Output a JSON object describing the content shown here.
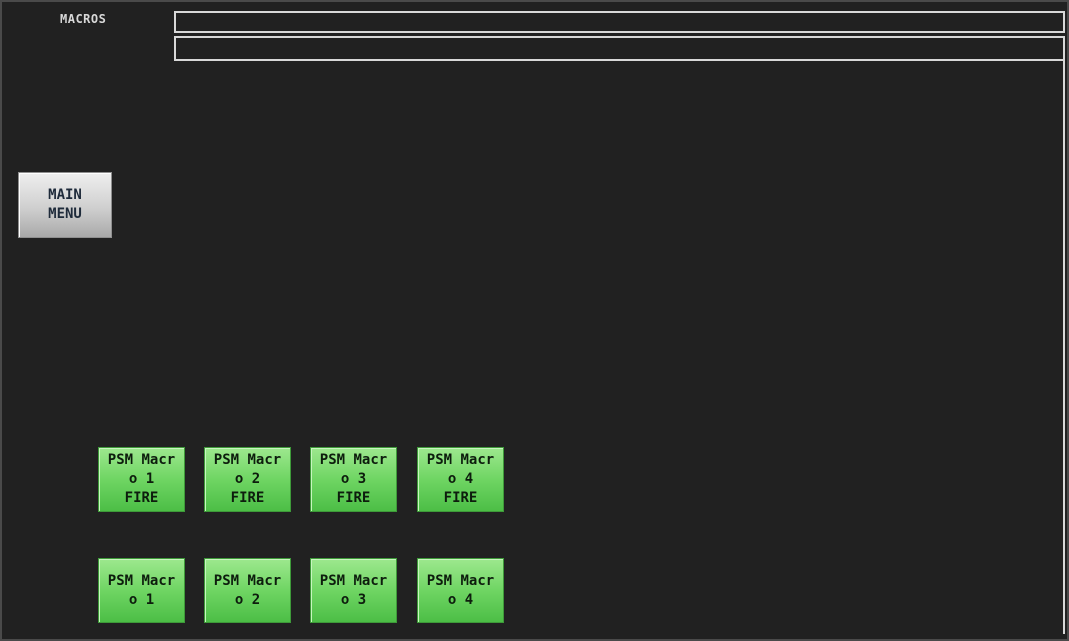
{
  "page": {
    "title": "MACROS"
  },
  "nav": {
    "main_menu_label": "MAIN\nMENU"
  },
  "macros": {
    "fire_buttons": [
      {
        "label": "PSM Macr\no 1\nFIRE"
      },
      {
        "label": "PSM Macr\no 2\nFIRE"
      },
      {
        "label": "PSM Macr\no 3\nFIRE"
      },
      {
        "label": "PSM Macr\no 4\nFIRE"
      }
    ],
    "select_buttons": [
      {
        "label": "PSM Macr\no 1"
      },
      {
        "label": "PSM Macr\no 2"
      },
      {
        "label": "PSM Macr\no 3"
      },
      {
        "label": "PSM Macr\no 4"
      }
    ]
  },
  "colors": {
    "background": "#212121",
    "button_green": "#6fd563",
    "button_gray": "#cfcfcf",
    "text_light": "#d8d8d8"
  }
}
